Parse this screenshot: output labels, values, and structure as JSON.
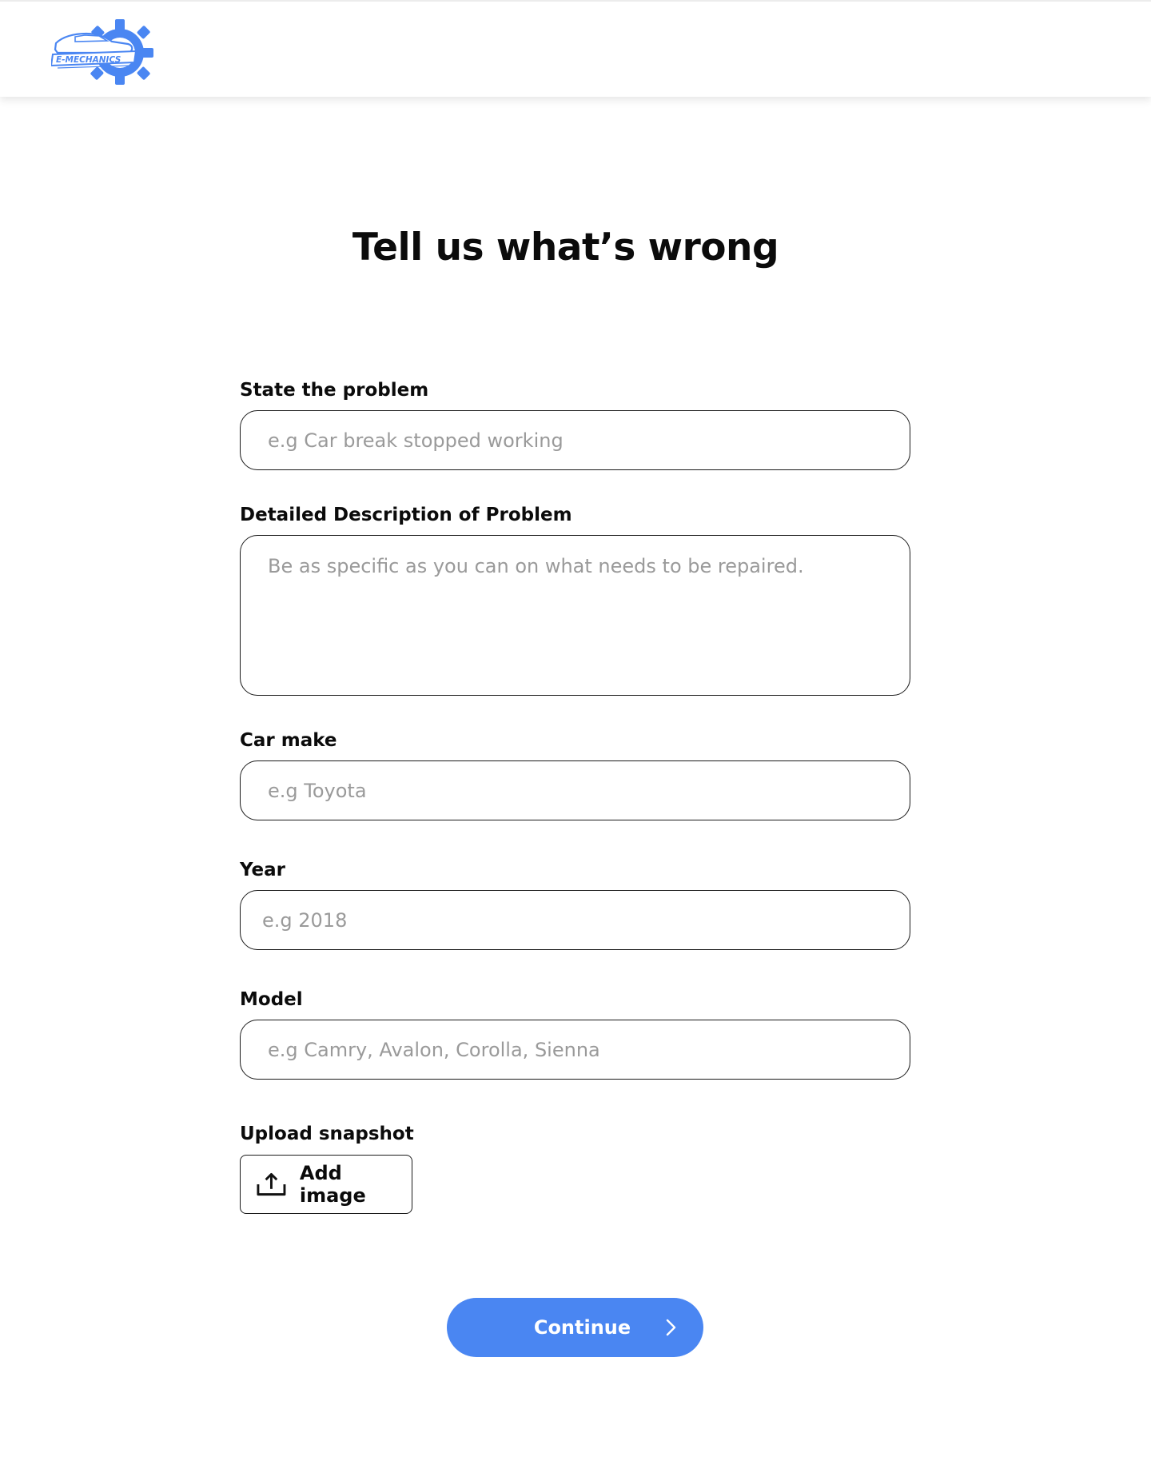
{
  "header": {
    "logo": {
      "text": "E-MECHANICS",
      "icon": "gear-car-logo-icon",
      "color": "#4a86f2"
    }
  },
  "main": {
    "title": "Tell us what’s wrong",
    "fields": {
      "problem": {
        "label": "State the problem",
        "placeholder": "e.g Car break stopped working"
      },
      "description": {
        "label": "Detailed Description of Problem",
        "placeholder": "Be as specific as you can on what needs to be repaired."
      },
      "make": {
        "label": "Car make",
        "placeholder": "e.g Toyota"
      },
      "year": {
        "label": "Year",
        "placeholder": "e.g 2018"
      },
      "model": {
        "label": "Model",
        "placeholder": "e.g Camry, Avalon, Corolla, Sienna"
      }
    },
    "upload": {
      "label": "Upload snapshot",
      "button_label": "Add image",
      "icon": "upload-icon"
    },
    "continue": {
      "label": "Continue",
      "icon": "chevron-right-icon",
      "color": "#4a86f2"
    }
  }
}
